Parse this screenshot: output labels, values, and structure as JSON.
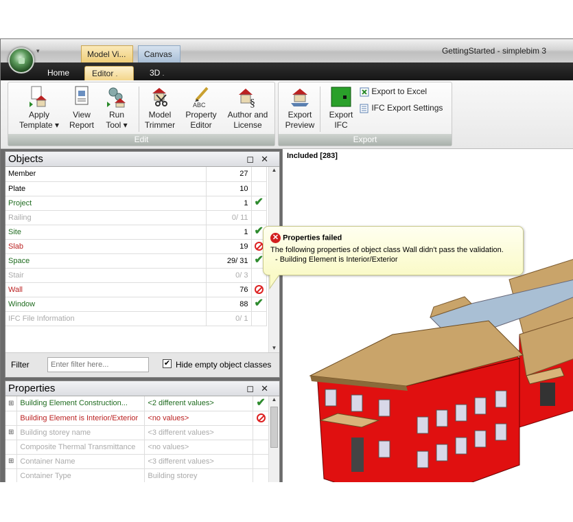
{
  "window": {
    "qat": "▾",
    "context_tab_1": "Model Vi...",
    "context_tab_2": "Canvas",
    "app_title": "GettingStarted - simplebim 3"
  },
  "tabs": {
    "home": "Home",
    "editor": "Editor",
    "editor_key": ".",
    "3d": "3D",
    "3d_key": "."
  },
  "ribbon": {
    "edit_group": "Edit",
    "export_group": "Export",
    "apply_template": [
      "Apply",
      "Template ▾"
    ],
    "view_report": [
      "View",
      "Report"
    ],
    "run_tool": [
      "Run",
      "Tool ▾"
    ],
    "model_trimmer": [
      "Model",
      "Trimmer"
    ],
    "property_editor": [
      "Property",
      "Editor"
    ],
    "author_license": [
      "Author and",
      "License"
    ],
    "export_preview": [
      "Export",
      "Preview"
    ],
    "export_ifc": [
      "Export",
      "IFC"
    ],
    "export_excel": "Export to Excel",
    "ifc_export_settings": "IFC Export Settings",
    "abc": "ABC",
    "section": "§"
  },
  "objects": {
    "title": "Objects",
    "pin": "◻",
    "close": "✕",
    "rows": [
      {
        "name": "Member",
        "count": "27",
        "status": "",
        "color": "#000"
      },
      {
        "name": "Plate",
        "count": "10",
        "status": "",
        "color": "#000"
      },
      {
        "name": "Project",
        "count": "1",
        "status": "ok",
        "color": "#1f6b1f"
      },
      {
        "name": "Railing",
        "count": "0/ 11",
        "status": "",
        "color": "#aaa"
      },
      {
        "name": "Site",
        "count": "1",
        "status": "ok",
        "color": "#1f6b1f"
      },
      {
        "name": "Slab",
        "count": "19",
        "status": "fail",
        "color": "#b22"
      },
      {
        "name": "Space",
        "count": "29/ 31",
        "status": "ok",
        "color": "#1f6b1f"
      },
      {
        "name": "Stair",
        "count": "0/ 3",
        "status": "",
        "color": "#aaa"
      },
      {
        "name": "Wall",
        "count": "76",
        "status": "fail",
        "color": "#b22"
      },
      {
        "name": "Window",
        "count": "88",
        "status": "ok",
        "color": "#1f6b1f"
      },
      {
        "name": "IFC File Information",
        "count": "0/ 1",
        "status": "",
        "color": "#aaa"
      }
    ],
    "filter_label": "Filter",
    "filter_placeholder": "Enter filter here...",
    "hide_empty": "Hide empty object classes"
  },
  "properties": {
    "title": "Properties",
    "pin": "◻",
    "close": "✕",
    "rows": [
      {
        "expand": "⊞",
        "name": "Building Element Construction...",
        "value": "<2 different values>",
        "status": "ok",
        "color": "#1f6b1f"
      },
      {
        "expand": "",
        "name": "Building Element is Interior/Exterior",
        "value": "<no values>",
        "status": "fail",
        "color": "#b22"
      },
      {
        "expand": "⊞",
        "name": "Building storey name",
        "value": "<3 different values>",
        "status": "",
        "color": "#aaa"
      },
      {
        "expand": "",
        "name": "Composite Thermal Transmittance",
        "value": "<no values>",
        "status": "",
        "color": "#aaa"
      },
      {
        "expand": "⊞",
        "name": "Container Name",
        "value": "<3 different values>",
        "status": "",
        "color": "#aaa"
      },
      {
        "expand": "",
        "name": "Container Type",
        "value": "Building storey",
        "status": "",
        "color": "#aaa"
      }
    ]
  },
  "viewport": {
    "included": "Included [283]"
  },
  "tooltip": {
    "title": "Properties failed",
    "line1": "The following properties of object class Wall didn't pass the validation.",
    "line2": "- Building Element is Interior/Exterior",
    "icon": "✕"
  },
  "colors": {
    "wall": "#e01010",
    "roof": "#c9a46a",
    "ok": "#2e8b2e",
    "fail": "#d22"
  }
}
